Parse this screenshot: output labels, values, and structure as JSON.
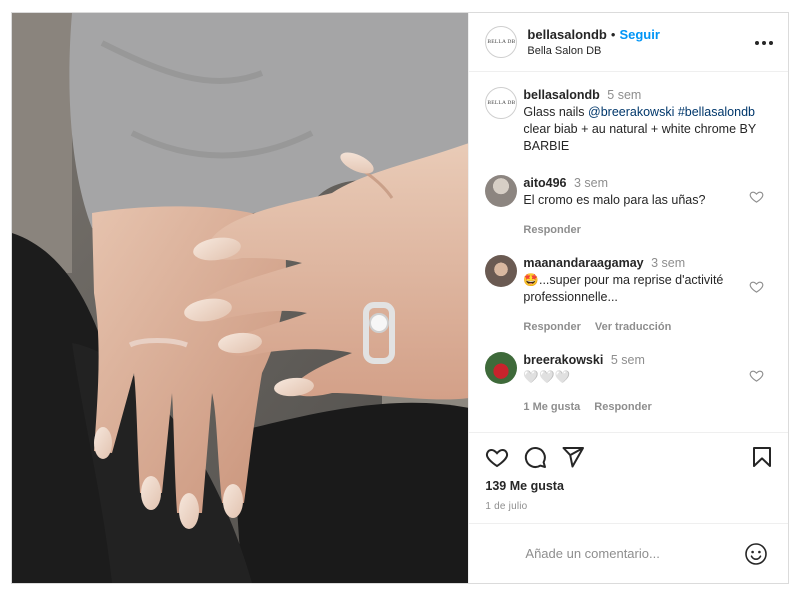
{
  "post": {
    "username": "bellasalondb",
    "follow_separator": "•",
    "follow_label": "Seguir",
    "display_name": "Bella Salon DB",
    "avatar_text": "BELLA DB",
    "more_icon": "more-horizontal-icon"
  },
  "caption": {
    "username": "bellasalondb",
    "time": "5 sem",
    "text_before": "Glass nails ",
    "mention": "@breerakowski",
    "text_middle": " ",
    "hashtag": "#bellasalondb",
    "text_after": " clear biab + au natural + white chrome BY BARBIE"
  },
  "comments": [
    {
      "username": "aito496",
      "time": "3 sem",
      "text": "El cromo es malo para las uñas?",
      "actions": [
        "Responder"
      ]
    },
    {
      "username": "maanandaraagamay",
      "time": "3 sem",
      "text": "🤩...super pour ma reprise d'activité professionnelle...",
      "actions": [
        "Responder",
        "Ver traducción"
      ]
    },
    {
      "username": "breerakowski",
      "time": "5 sem",
      "text": "🤍🤍🤍",
      "actions": [
        "1 Me gusta",
        "Responder"
      ]
    }
  ],
  "engagement": {
    "likes": "139 Me gusta",
    "date": "1 de julio"
  },
  "composer": {
    "placeholder": "Añade un comentario..."
  },
  "colors": {
    "accent": "#0095f6",
    "link": "#00376b",
    "muted": "#8e8e8e"
  }
}
